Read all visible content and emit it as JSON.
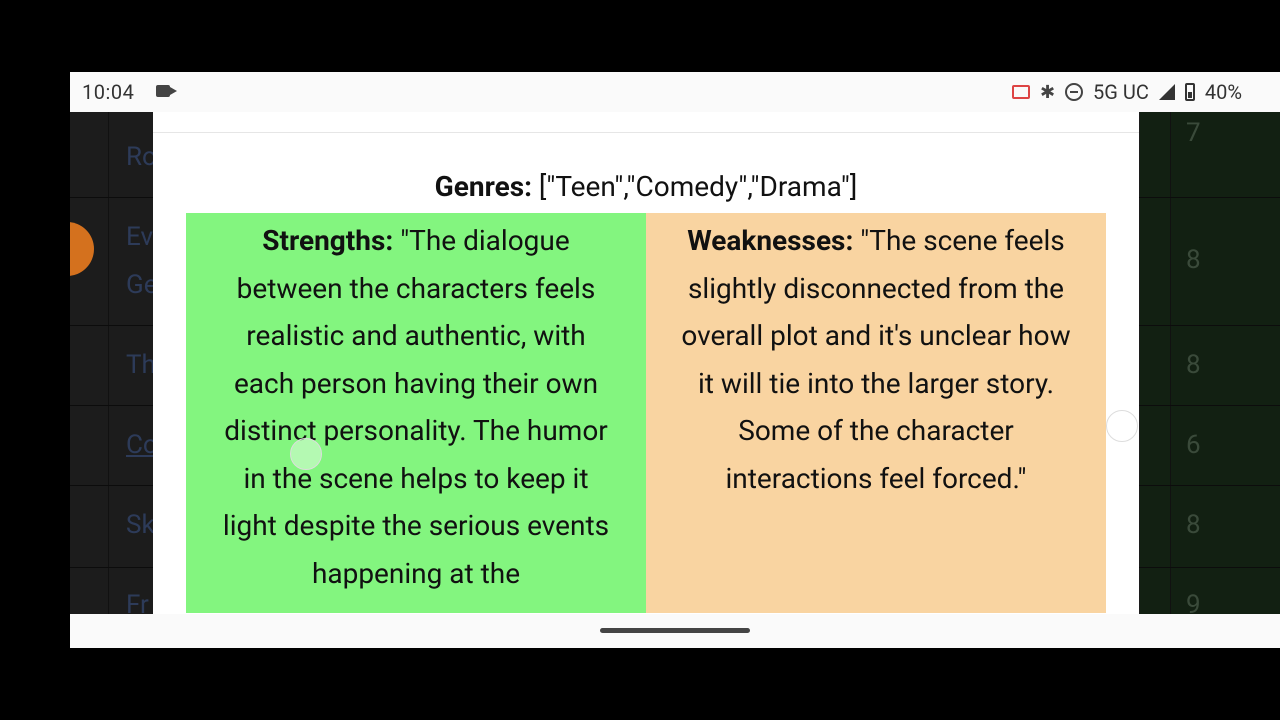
{
  "status_bar": {
    "time": "10:04",
    "network": "5G UC",
    "battery": "40%",
    "icons": [
      "video-camera-icon",
      "cast-icon",
      "bluetooth-icon",
      "do-not-disturb-icon",
      "signal-icon",
      "battery-icon"
    ]
  },
  "background_sheet": {
    "left_snippets": [
      "Ro",
      "Ev",
      "Ge",
      "Th",
      "Co",
      "Sk",
      "Fr"
    ],
    "right_numbers": [
      "7",
      "8",
      "8",
      "6",
      "8",
      "9"
    ]
  },
  "modal": {
    "genres_label": "Genres:",
    "genres_value": "[\"Teen\",\"Comedy\",\"Drama\"]",
    "strengths_label": "Strengths:",
    "strengths_text": "\"The dialogue between the characters feels realistic and authentic, with each person having their own distinct personality. The humor in the scene helps to keep it light despite the serious events happening at the",
    "weaknesses_label": "Weaknesses:",
    "weaknesses_text": "\"The scene feels slightly disconnected from the overall plot and it's unclear how it will tie into the larger story. Some of the character interactions feel forced.\""
  },
  "colors": {
    "strengths_bg": "#83f57f",
    "weaknesses_bg": "#f9d4a1"
  }
}
